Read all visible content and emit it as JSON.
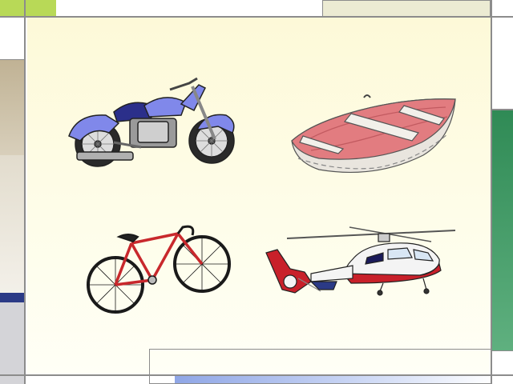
{
  "slide": {
    "theme_colors": {
      "top_left_block": "#b8d957",
      "top_right_block": "#ecebd3",
      "left_strip_top": "#c4b79a",
      "left_strip_mid": "#d9d2c0",
      "left_navy_band": "#2b3a86",
      "right_green_bar": "#2f8a55",
      "bottom_gradient_start": "#8fa6e6",
      "bottom_gradient_end": "#ffffff",
      "panel_background": "#fdf9d8",
      "border_lines": "#8c8c8c"
    },
    "pictures": [
      {
        "name": "motorcycle",
        "icon": "motorcycle-icon",
        "color": "#8088ea"
      },
      {
        "name": "rowboat",
        "icon": "boat-icon",
        "color": "#e27c80"
      },
      {
        "name": "bicycle",
        "icon": "bicycle-icon",
        "color": "#c8282c"
      },
      {
        "name": "helicopter",
        "icon": "helicopter-icon",
        "color": "#c8202a"
      }
    ]
  }
}
